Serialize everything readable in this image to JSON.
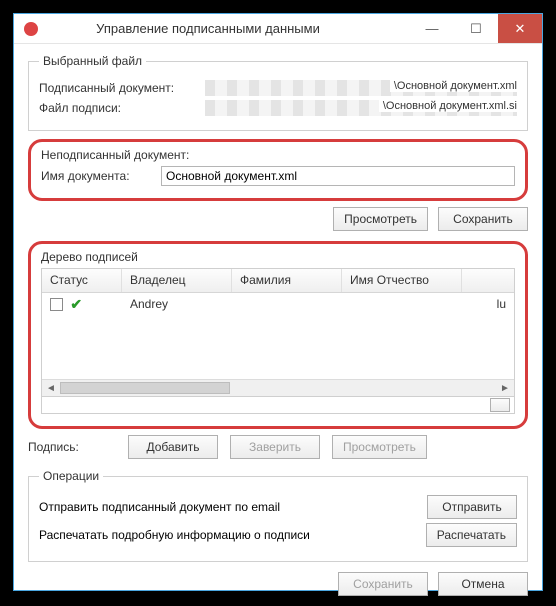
{
  "window": {
    "title": "Управление подписанными данными"
  },
  "selected_file": {
    "legend": "Выбранный файл",
    "signed_doc_label": "Подписанный документ:",
    "signed_doc_tail": "\\Основной документ.xml",
    "sig_file_label": "Файл подписи:",
    "sig_file_tail": "\\Основной документ.xml.si"
  },
  "unsigned": {
    "legend": "Неподписанный документ:",
    "name_label": "Имя документа:",
    "name_value": "Основной документ.xml",
    "btn_view": "Просмотреть",
    "btn_save": "Сохранить"
  },
  "tree": {
    "legend": "Дерево подписей",
    "cols": {
      "status": "Статус",
      "owner": "Владелец",
      "surname": "Фамилия",
      "name_patr": "Имя Отчество"
    },
    "row": {
      "owner": "Andrey",
      "tail": "lu"
    }
  },
  "signature": {
    "label": "Подпись:",
    "btn_add": "Добавить",
    "btn_certify": "Заверить",
    "btn_view": "Просмотреть"
  },
  "ops": {
    "legend": "Операции",
    "email_label": "Отправить подписанный документ по email",
    "btn_send": "Отправить",
    "print_label": "Распечатать подробную информацию о подписи",
    "btn_print": "Распечатать"
  },
  "dialog": {
    "btn_save": "Сохранить",
    "btn_cancel": "Отмена"
  }
}
